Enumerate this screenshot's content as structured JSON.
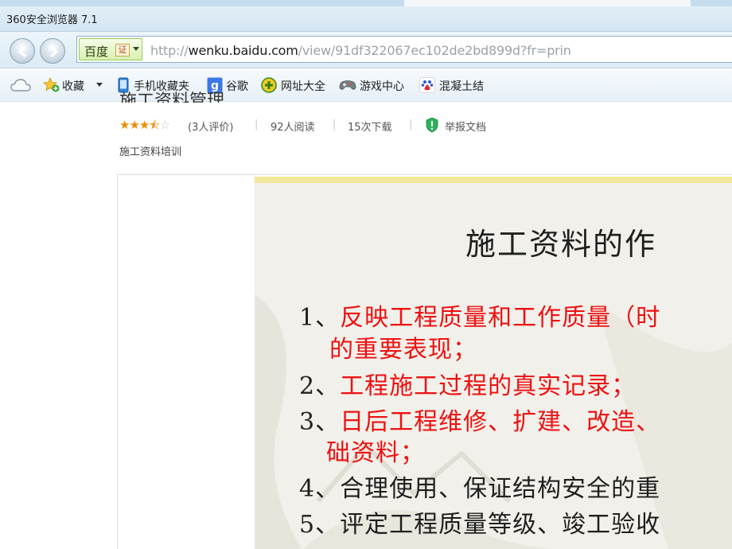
{
  "window": {
    "title": "360安全浏览器 7.1"
  },
  "address": {
    "site_name": "百度",
    "cert_label": "证",
    "url_prefix": "http://",
    "url_domain": "wenku.baidu.com",
    "url_path": "/view/91df322067ec102de2bd899d?fr=prin"
  },
  "bookmarks": [
    {
      "label": "收藏",
      "icon": "star-add-icon"
    },
    {
      "label": "手机收藏夹",
      "icon": "phone-icon"
    },
    {
      "label": "谷歌",
      "icon": "google-icon"
    },
    {
      "label": "网址大全",
      "icon": "plus-circle-icon"
    },
    {
      "label": "游戏中心",
      "icon": "gamepad-icon"
    },
    {
      "label": "混凝土结",
      "icon": "baidu-paw-icon"
    }
  ],
  "document": {
    "title_partial": "施工资料管理",
    "rating": {
      "stars": 3.5,
      "max": 5,
      "label": "(3人评价)"
    },
    "reads": "92人阅读",
    "downloads": "15次下载",
    "report": "举报文档",
    "category": "施工资料培训"
  },
  "slide": {
    "title": "施工资料的作",
    "items": [
      {
        "num": "1、",
        "text": "反映工程质量和工作质量（时",
        "cont": "的重要表现；",
        "color": "red"
      },
      {
        "num": "2、",
        "text": "工程施工过程的真实记录；",
        "color": "red"
      },
      {
        "num": "3、",
        "text": "日后工程维修、扩建、改造、",
        "cont": "础资料；",
        "color": "red"
      },
      {
        "num": "4、",
        "text": "合理使用、保证结构安全的重",
        "color": "black"
      },
      {
        "num": "5、",
        "text": "评定工程质量等级、竣工验收",
        "color": "black"
      }
    ]
  },
  "colors": {
    "accent_red": "#ee1111",
    "star": "#f08a00",
    "badge_green": "#d7f0b0"
  }
}
